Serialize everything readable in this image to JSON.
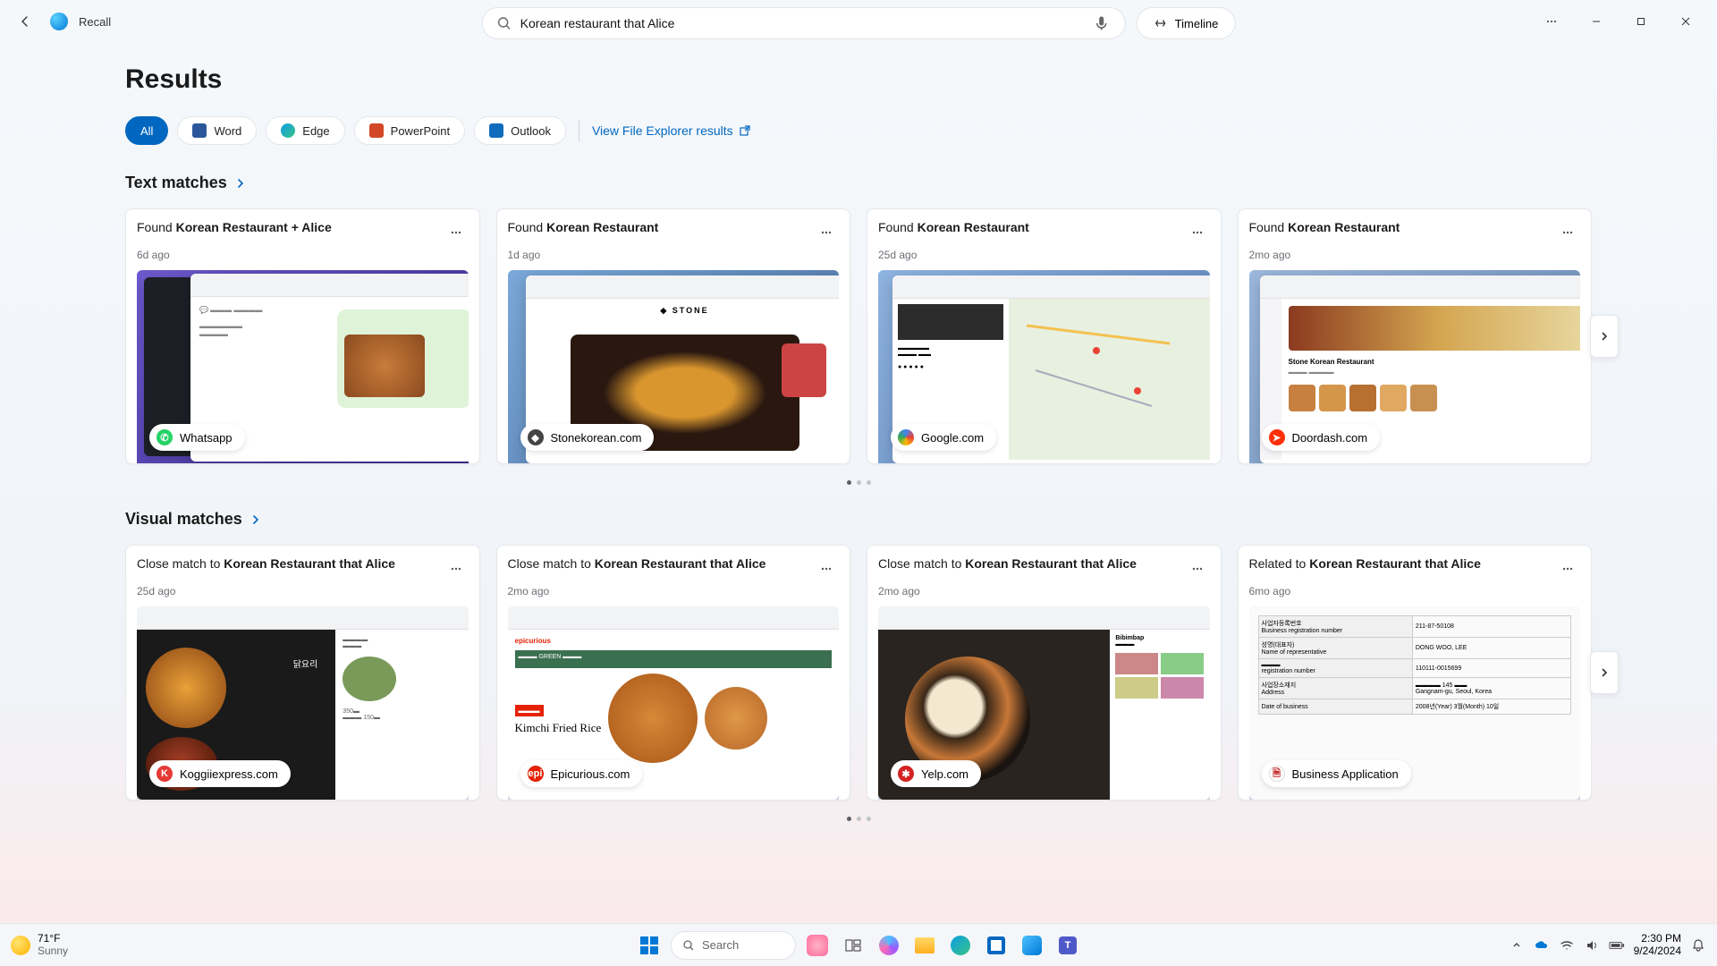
{
  "app": {
    "name": "Recall"
  },
  "search": {
    "value": "Korean restaurant that Alice",
    "placeholder": ""
  },
  "timeline_label": "Timeline",
  "page_title": "Results",
  "filters": {
    "all": "All",
    "items": [
      {
        "label": "Word",
        "color": "#2b579a"
      },
      {
        "label": "Edge",
        "color": "#0078d7"
      },
      {
        "label": "PowerPoint",
        "color": "#d24726"
      },
      {
        "label": "Outlook",
        "color": "#0f6cbd"
      }
    ],
    "fe_link": "View File Explorer results"
  },
  "sections": {
    "text": {
      "title": "Text matches",
      "cards": [
        {
          "prefix": "Found ",
          "bold": "Korean Restaurant + Alice",
          "time": "6d ago",
          "source": "Whatsapp",
          "source_color": "#25d366"
        },
        {
          "prefix": "Found ",
          "bold": "Korean Restaurant",
          "time": "1d ago",
          "source": "Stonekorean.com",
          "source_color": "#444444"
        },
        {
          "prefix": "Found ",
          "bold": "Korean Restaurant",
          "time": "25d ago",
          "source": "Google.com",
          "source_color": "#4285f4"
        },
        {
          "prefix": "Found ",
          "bold": "Korean Restaurant",
          "time": "2mo ago",
          "source": "Doordash.com",
          "source_color": "#ff3008"
        }
      ]
    },
    "visual": {
      "title": "Visual matches",
      "cards": [
        {
          "prefix": "Close match to ",
          "bold": "Korean Restaurant that Alice",
          "time": "25d ago",
          "source": "Koggiiexpress.com",
          "source_color": "#e53935"
        },
        {
          "prefix": "Close match to ",
          "bold": "Korean Restaurant that Alice",
          "time": "2mo ago",
          "source": "Epicurious.com",
          "source_color": "#e52207"
        },
        {
          "prefix": "Close match to ",
          "bold": "Korean Restaurant that Alice",
          "time": "2mo ago",
          "source": "Yelp.com",
          "source_color": "#d32323"
        },
        {
          "prefix": "Related to ",
          "bold": "Korean Restaurant that Alice",
          "time": "6mo ago",
          "source": "Business Application",
          "source_color": "#c62828"
        }
      ]
    }
  },
  "taskbar": {
    "weather": {
      "temp": "71°F",
      "desc": "Sunny"
    },
    "search_label": "Search",
    "time": "2:30 PM",
    "date": "9/24/2024"
  }
}
